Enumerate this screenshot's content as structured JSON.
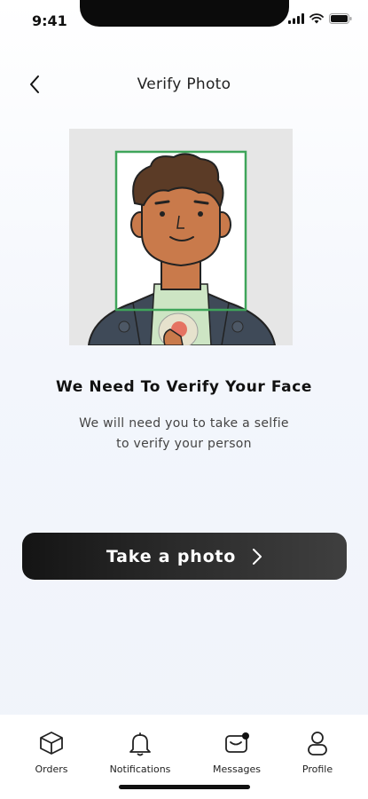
{
  "status_bar": {
    "time": "9:41"
  },
  "header": {
    "title": "Verify Photo",
    "back_icon": "chevron-left-icon"
  },
  "main": {
    "headline": "We Need To Verify Your Face",
    "subtext_line1": "We will need you to take a selfie",
    "subtext_line2": "to verify your person"
  },
  "action": {
    "label": "Take a photo",
    "icon": "chevron-right-icon"
  },
  "bottom_nav": {
    "items": [
      {
        "label": "Orders",
        "icon": "box-icon"
      },
      {
        "label": "Notifications",
        "icon": "bell-icon"
      },
      {
        "label": "Messages",
        "icon": "message-icon"
      },
      {
        "label": "Profile",
        "icon": "user-icon"
      }
    ]
  },
  "colors": {
    "face_frame": "#3fa55a",
    "button_dark": "#1c1c1c"
  }
}
